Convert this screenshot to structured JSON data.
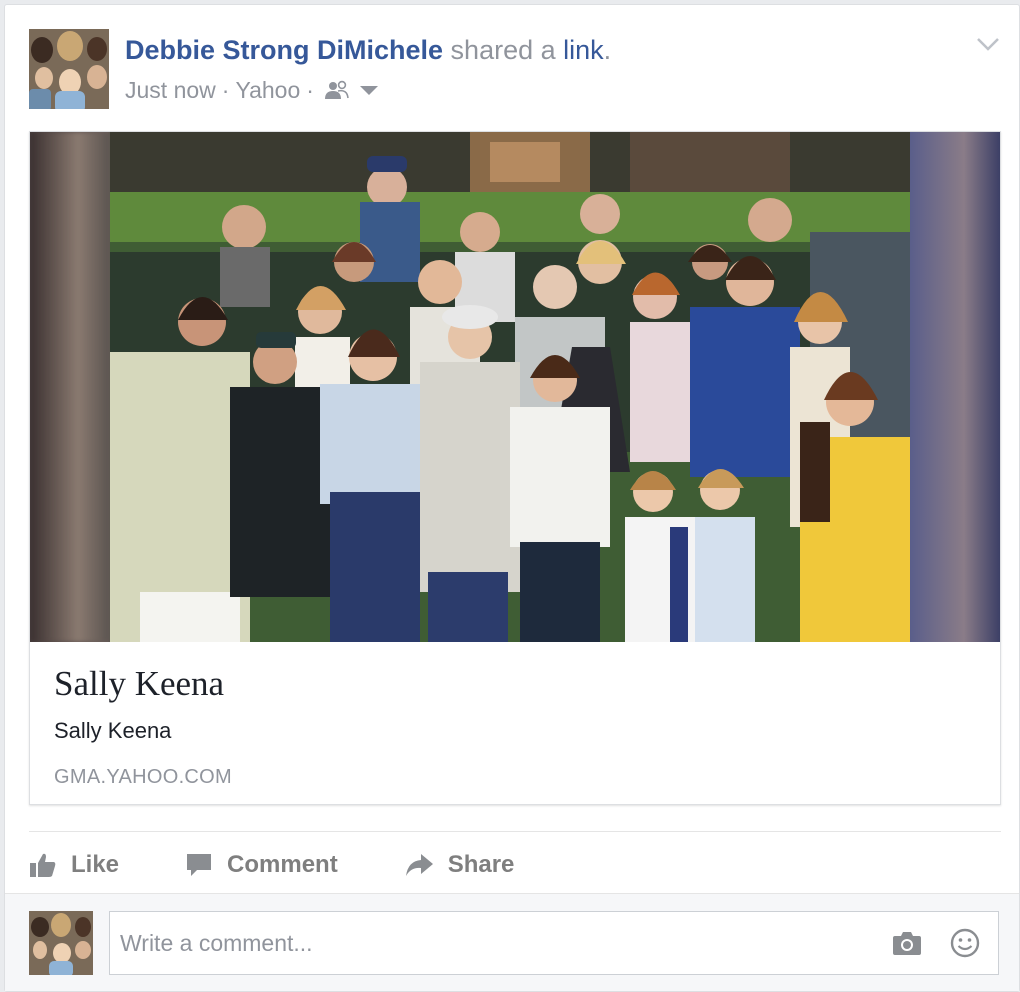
{
  "post": {
    "author_name": "Debbie Strong DiMichele",
    "action_text": " shared a ",
    "action_link": "link",
    "action_end": ".",
    "timestamp": "Just now",
    "separator": "·",
    "source": "Yahoo",
    "audience_icon": "friends-icon",
    "options_icon": "chevron-down-icon"
  },
  "preview": {
    "image_description_icon": "group-photo",
    "title": "Sally Keena",
    "description": "Sally Keena",
    "domain": "GMA.YAHOO.COM"
  },
  "actions": {
    "like_label": "Like",
    "comment_label": "Comment",
    "share_label": "Share"
  },
  "comment": {
    "placeholder": "Write a comment...",
    "camera_icon": "camera-icon",
    "emoji_icon": "emoji-icon"
  },
  "colors": {
    "link_blue": "#365899",
    "meta_gray": "#90949c",
    "action_gray": "#7f7f7f"
  }
}
